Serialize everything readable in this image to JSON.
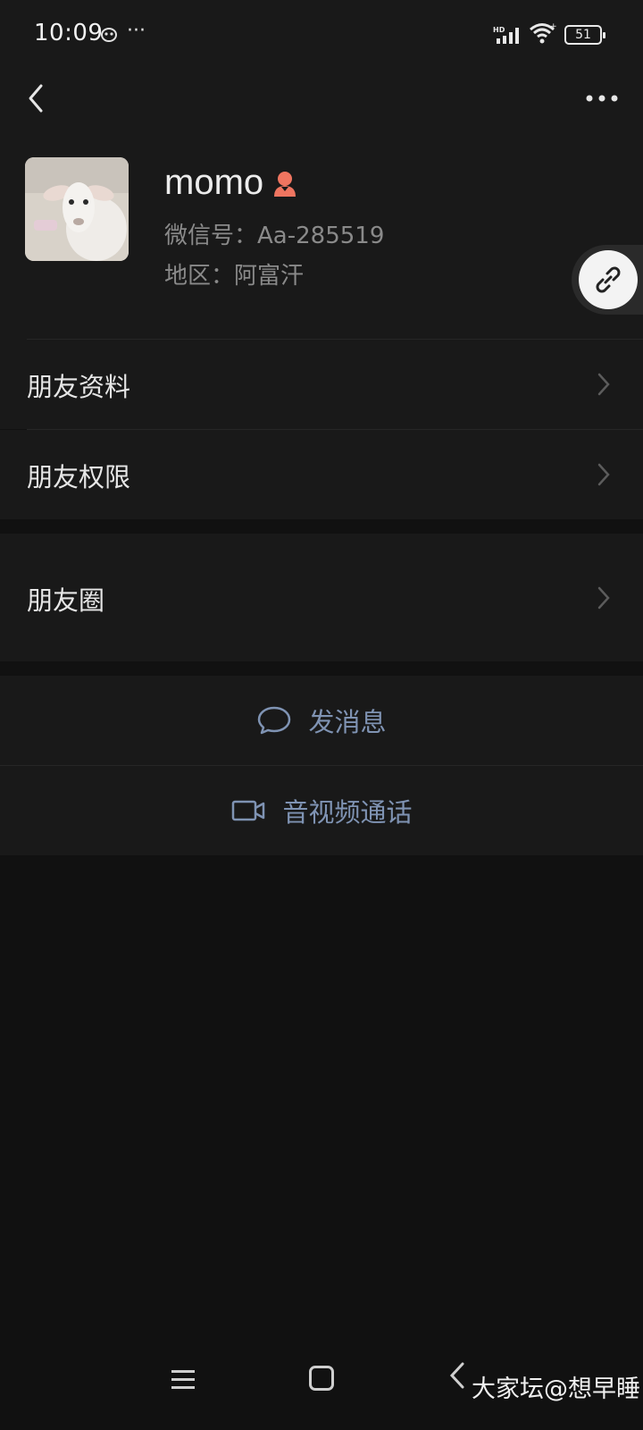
{
  "status_bar": {
    "time": "10:09",
    "dots": "···",
    "battery": "51"
  },
  "profile": {
    "name": "momo",
    "wxid_label": "微信号：",
    "wxid": "Aa-285519",
    "region_label": "地区：",
    "region": "阿富汗"
  },
  "menu": {
    "items": [
      {
        "label": "朋友资料"
      },
      {
        "label": "朋友权限"
      },
      {
        "label": "朋友圈"
      }
    ]
  },
  "actions": {
    "message": "发消息",
    "call": "音视频通话"
  },
  "watermark": "大家坛@想早睡",
  "colors": {
    "background": "#111111",
    "panel": "#191919",
    "action_blue": "#7f93b3",
    "gender_female": "#ef7560"
  },
  "icons": [
    "back-arrow-icon",
    "more-icon",
    "link-icon",
    "chevron-right-icon",
    "chat-bubble-icon",
    "video-camera-icon"
  ]
}
